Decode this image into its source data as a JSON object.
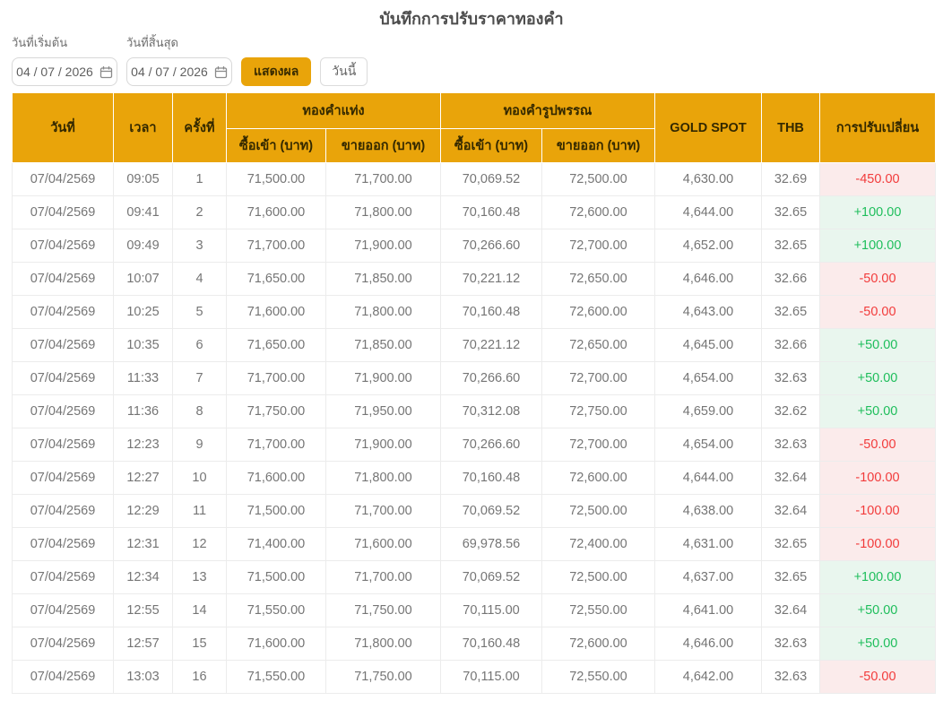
{
  "page": {
    "title": "บันทึกการปรับราคาทองคำ"
  },
  "filters": {
    "start_date": {
      "label": "วันที่เริ่มต้น",
      "value": "04 / 07 / 2026"
    },
    "end_date": {
      "label": "วันที่สิ้นสุด",
      "value": "04 / 07 / 2026"
    },
    "show_button_label": "แสดงผล",
    "today_button_label": "วันนี้",
    "calendar_icon": "calendar-icon"
  },
  "colors": {
    "accent_gold": "#e9a40a",
    "header_text": "#332800",
    "positive_text": "#1fbe5c",
    "positive_bg": "#e9f6ee",
    "negative_text": "#f23b3b",
    "negative_bg": "#fbebeb",
    "body_text": "#757575"
  },
  "table": {
    "headers": {
      "date": "วันที่",
      "time": "เวลา",
      "round": "ครั้งที่",
      "bar_group": "ทองคำแท่ง",
      "ornament_group": "ทองคำรูปพรรณ",
      "buy": "ซื้อเข้า (บาท)",
      "sell": "ขายออก (บาท)",
      "gold_spot": "GOLD SPOT",
      "thb": "THB",
      "change": "การปรับเปลี่ยน"
    },
    "cell_names": [
      "cell-date",
      "cell-time",
      "cell-round",
      "cell-bar-buy",
      "cell-bar-sell",
      "cell-ornament-buy",
      "cell-ornament-sell",
      "cell-gold-spot",
      "cell-thb",
      "cell-change"
    ],
    "rows": [
      {
        "values": [
          "07/04/2569",
          "09:05",
          "1",
          "71,500.00",
          "71,700.00",
          "70,069.52",
          "72,500.00",
          "4,630.00",
          "32.69",
          "-450.00"
        ],
        "trend": "down"
      },
      {
        "values": [
          "07/04/2569",
          "09:41",
          "2",
          "71,600.00",
          "71,800.00",
          "70,160.48",
          "72,600.00",
          "4,644.00",
          "32.65",
          "+100.00"
        ],
        "trend": "up"
      },
      {
        "values": [
          "07/04/2569",
          "09:49",
          "3",
          "71,700.00",
          "71,900.00",
          "70,266.60",
          "72,700.00",
          "4,652.00",
          "32.65",
          "+100.00"
        ],
        "trend": "up"
      },
      {
        "values": [
          "07/04/2569",
          "10:07",
          "4",
          "71,650.00",
          "71,850.00",
          "70,221.12",
          "72,650.00",
          "4,646.00",
          "32.66",
          "-50.00"
        ],
        "trend": "down"
      },
      {
        "values": [
          "07/04/2569",
          "10:25",
          "5",
          "71,600.00",
          "71,800.00",
          "70,160.48",
          "72,600.00",
          "4,643.00",
          "32.65",
          "-50.00"
        ],
        "trend": "down"
      },
      {
        "values": [
          "07/04/2569",
          "10:35",
          "6",
          "71,650.00",
          "71,850.00",
          "70,221.12",
          "72,650.00",
          "4,645.00",
          "32.66",
          "+50.00"
        ],
        "trend": "up"
      },
      {
        "values": [
          "07/04/2569",
          "11:33",
          "7",
          "71,700.00",
          "71,900.00",
          "70,266.60",
          "72,700.00",
          "4,654.00",
          "32.63",
          "+50.00"
        ],
        "trend": "up"
      },
      {
        "values": [
          "07/04/2569",
          "11:36",
          "8",
          "71,750.00",
          "71,950.00",
          "70,312.08",
          "72,750.00",
          "4,659.00",
          "32.62",
          "+50.00"
        ],
        "trend": "up"
      },
      {
        "values": [
          "07/04/2569",
          "12:23",
          "9",
          "71,700.00",
          "71,900.00",
          "70,266.60",
          "72,700.00",
          "4,654.00",
          "32.63",
          "-50.00"
        ],
        "trend": "down"
      },
      {
        "values": [
          "07/04/2569",
          "12:27",
          "10",
          "71,600.00",
          "71,800.00",
          "70,160.48",
          "72,600.00",
          "4,644.00",
          "32.64",
          "-100.00"
        ],
        "trend": "down"
      },
      {
        "values": [
          "07/04/2569",
          "12:29",
          "11",
          "71,500.00",
          "71,700.00",
          "70,069.52",
          "72,500.00",
          "4,638.00",
          "32.64",
          "-100.00"
        ],
        "trend": "down"
      },
      {
        "values": [
          "07/04/2569",
          "12:31",
          "12",
          "71,400.00",
          "71,600.00",
          "69,978.56",
          "72,400.00",
          "4,631.00",
          "32.65",
          "-100.00"
        ],
        "trend": "down"
      },
      {
        "values": [
          "07/04/2569",
          "12:34",
          "13",
          "71,500.00",
          "71,700.00",
          "70,069.52",
          "72,500.00",
          "4,637.00",
          "32.65",
          "+100.00"
        ],
        "trend": "up"
      },
      {
        "values": [
          "07/04/2569",
          "12:55",
          "14",
          "71,550.00",
          "71,750.00",
          "70,115.00",
          "72,550.00",
          "4,641.00",
          "32.64",
          "+50.00"
        ],
        "trend": "up"
      },
      {
        "values": [
          "07/04/2569",
          "12:57",
          "15",
          "71,600.00",
          "71,800.00",
          "70,160.48",
          "72,600.00",
          "4,646.00",
          "32.63",
          "+50.00"
        ],
        "trend": "up"
      },
      {
        "values": [
          "07/04/2569",
          "13:03",
          "16",
          "71,550.00",
          "71,750.00",
          "70,115.00",
          "72,550.00",
          "4,642.00",
          "32.63",
          "-50.00"
        ],
        "trend": "down"
      }
    ]
  }
}
